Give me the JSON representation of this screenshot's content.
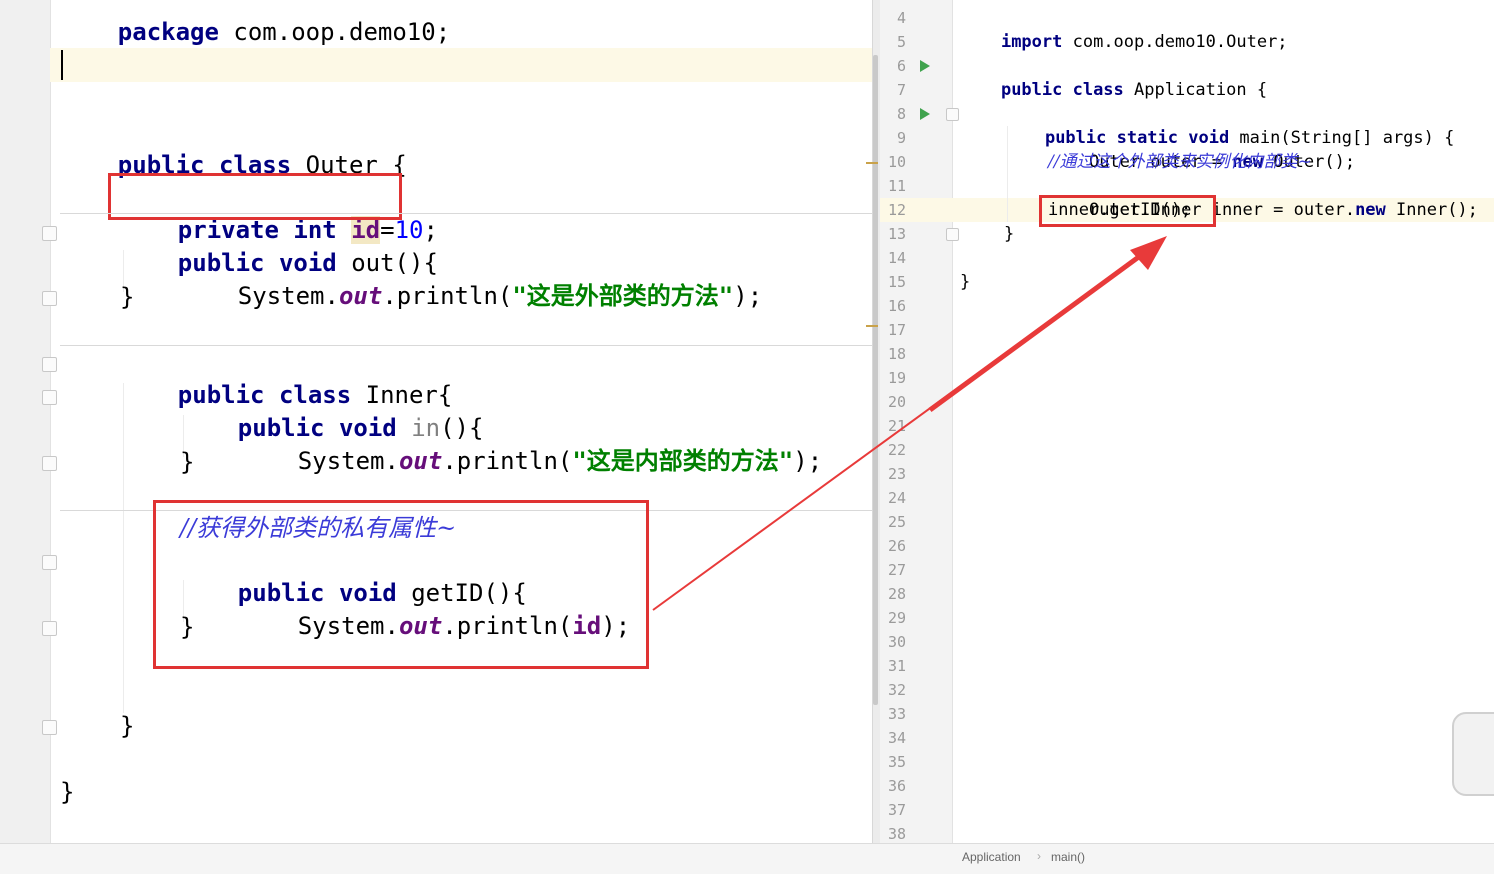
{
  "left_editor": {
    "lines": {
      "package": "package com.oop.demo10;",
      "class_decl": {
        "kw": "public class",
        "name": " Outer {"
      },
      "field": {
        "kw1": "private",
        "kw2": " int",
        "field": "id",
        "eq": "=",
        "num": "10",
        "end": ";"
      },
      "out_method": {
        "kw": "public void",
        "rest": " out(){"
      },
      "out_body": {
        "pre": "System.",
        "out": "out",
        "mid": ".println(",
        "str": "\"这是外部类的方法\"",
        "end": ");"
      },
      "close1": "}",
      "inner_decl": {
        "kw": "public class",
        "rest": " Inner{"
      },
      "in_method": {
        "kw": "public void",
        "name": " in",
        "rest": "(){"
      },
      "in_body": {
        "pre": "System.",
        "out": "out",
        "mid": ".println(",
        "str": "\"这是内部类的方法\"",
        "end": ");"
      },
      "close2": "}",
      "comment": "//获得外部类的私有属性~",
      "getid_method": {
        "kw": "public void",
        "rest": " getID(){"
      },
      "getid_body": {
        "pre": "System.",
        "out": "out",
        "mid": ".println(",
        "field": "id",
        "end": ");"
      },
      "close3": "}",
      "close4": "}",
      "close5": "}"
    }
  },
  "right_editor": {
    "line_numbers": [
      "4",
      "5",
      "6",
      "7",
      "8",
      "9",
      "10",
      "11",
      "12",
      "13",
      "14",
      "15",
      "16",
      "17",
      "18",
      "19",
      "20",
      "21",
      "22",
      "23",
      "24",
      "25",
      "26",
      "27",
      "28",
      "29",
      "30",
      "31",
      "32",
      "33",
      "34",
      "35",
      "36",
      "37",
      "38"
    ],
    "lines": {
      "import": {
        "kw": "import",
        "rest": " com.oop.demo10.Outer;"
      },
      "class_decl": {
        "kw": "public class",
        "rest": " Application {"
      },
      "main_decl": {
        "kw": "public static void",
        "rest": " main(String[] args) {"
      },
      "outer_new": {
        "pre": "Outer outer = ",
        "kw": "new",
        "rest": " Outer();"
      },
      "comment": "//通过这个外部类来实例化内部类~",
      "inner_new": {
        "pre": "Outer.Inner inner = outer.",
        "kw": "new",
        "rest": " Inner();"
      },
      "call": "inner.getID();",
      "close_main": "}",
      "close_class": "}"
    }
  },
  "status_bar": {
    "breadcrumb_class": "Application",
    "breadcrumb_sep": "›",
    "breadcrumb_method": "main()"
  },
  "colors": {
    "highlight_box": "#e03333",
    "keyword": "#000080",
    "string": "#008000",
    "comment": "#3b3bd8",
    "field": "#660e7a"
  }
}
